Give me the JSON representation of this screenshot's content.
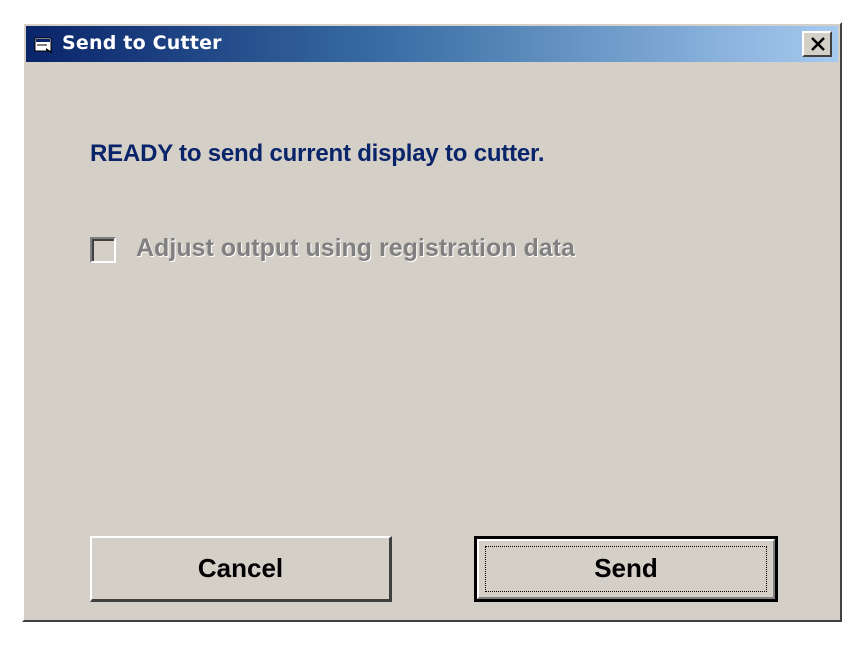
{
  "window": {
    "title": "Send to Cutter",
    "icon": "cutter-app-icon",
    "close_icon": "close-icon"
  },
  "content": {
    "ready_message": "READY to send current display to cutter.",
    "adjust_checkbox": {
      "label": "Adjust output using registration data",
      "checked": false,
      "enabled": false
    }
  },
  "buttons": {
    "cancel_label": "Cancel",
    "send_label": "Send"
  },
  "colors": {
    "title_gradient_start": "#0a246a",
    "title_gradient_end": "#a6caf0",
    "dialog_face": "#d4d0c8",
    "message_text": "#0a246a",
    "disabled_text": "#808080"
  }
}
